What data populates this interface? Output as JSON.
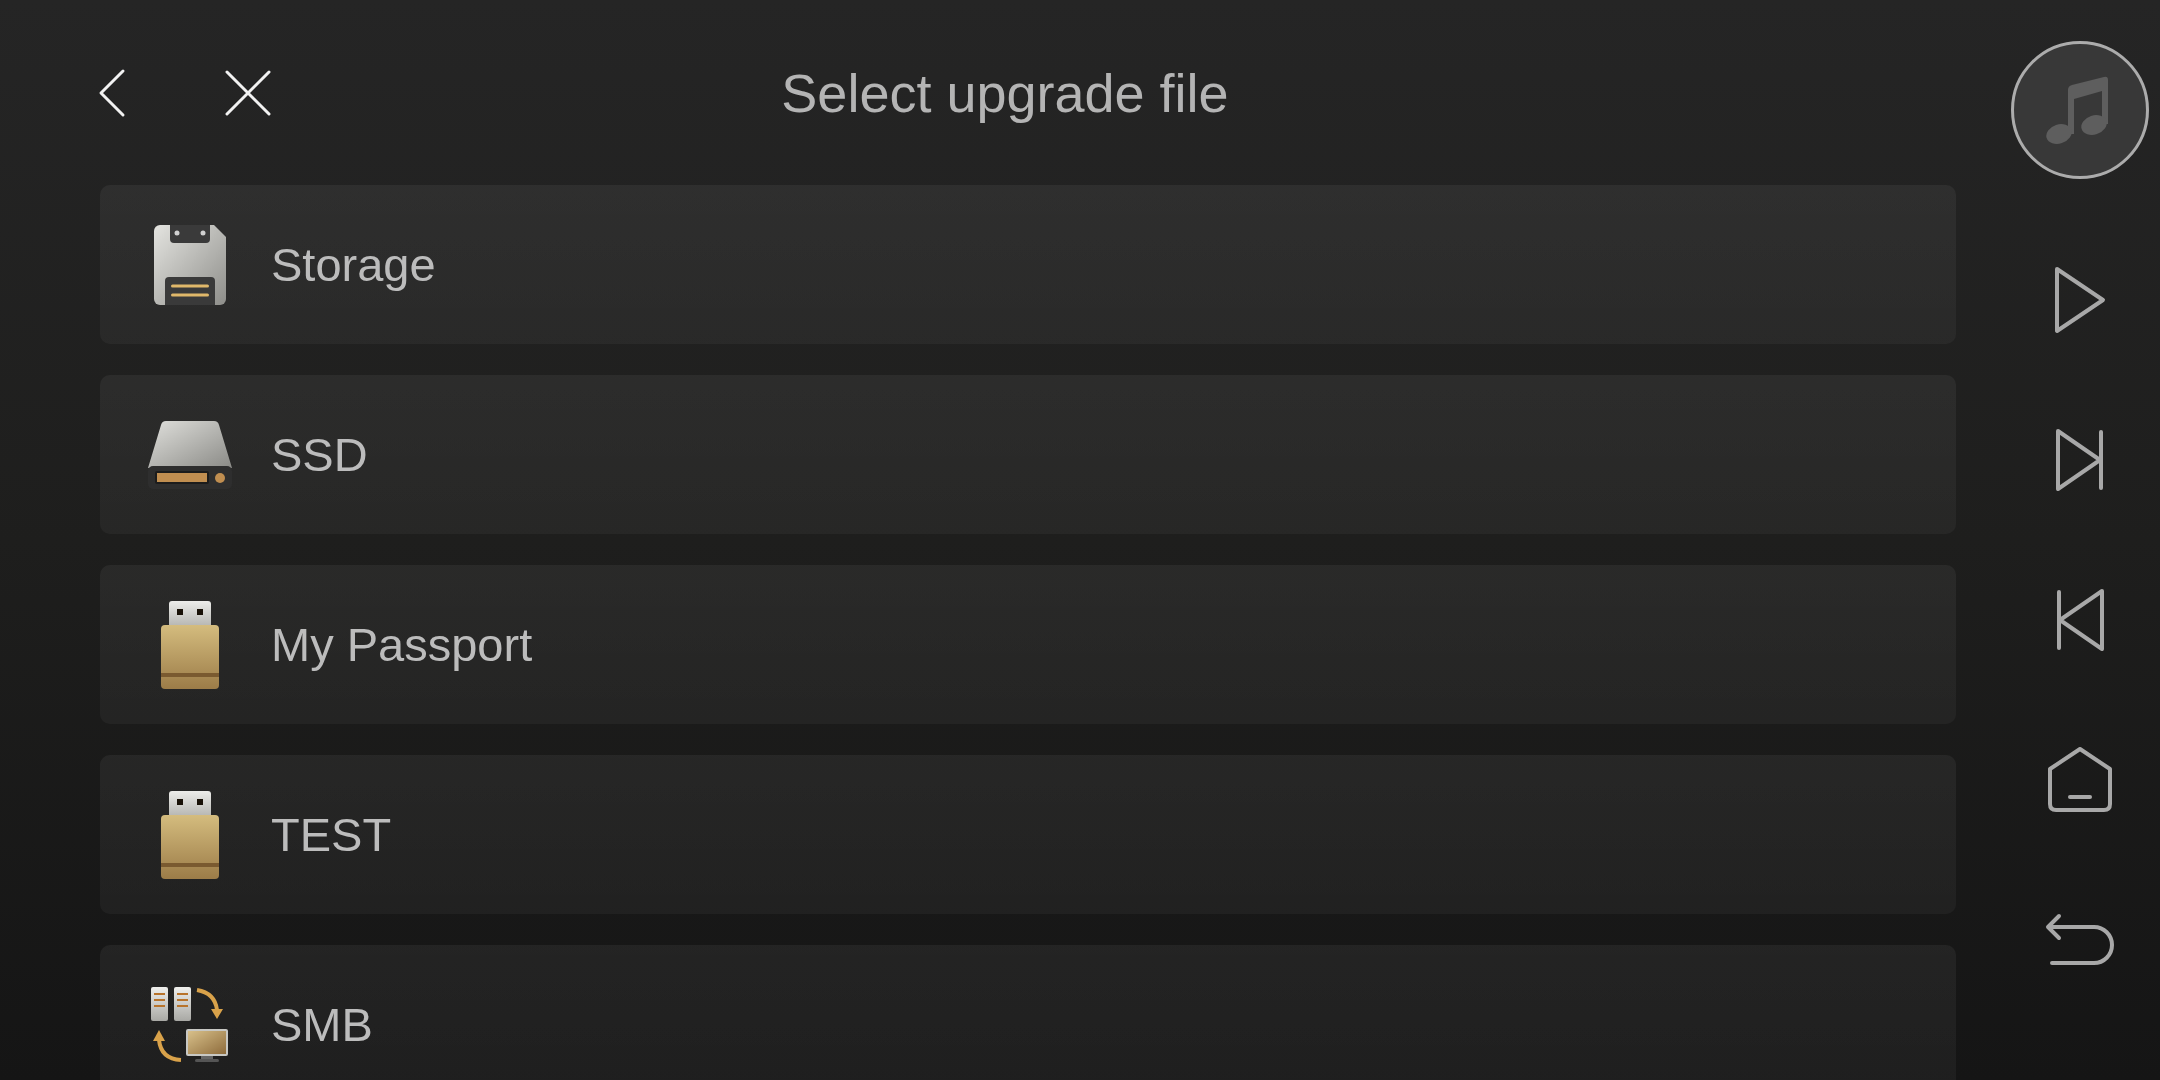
{
  "header": {
    "title": "Select upgrade file"
  },
  "sources": [
    {
      "kind": "storage",
      "label": "Storage"
    },
    {
      "kind": "ssd",
      "label": "SSD"
    },
    {
      "kind": "usb",
      "label": "My Passport"
    },
    {
      "kind": "usb",
      "label": "TEST"
    },
    {
      "kind": "smb",
      "label": "SMB"
    }
  ]
}
